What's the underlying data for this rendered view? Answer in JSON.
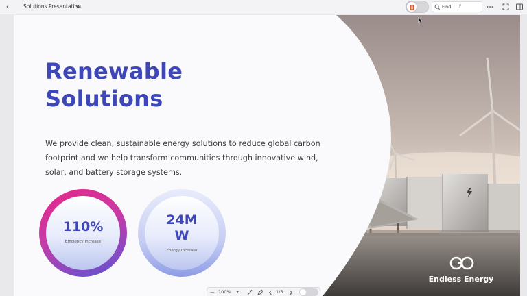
{
  "toolbar": {
    "back_icon": "chevron-left-icon",
    "document_title": "Solutions Presentation",
    "find_label": "Find",
    "find_shortcut": "F",
    "more_icon": "more-horizontal-icon",
    "fullscreen_icon": "fullscreen-icon",
    "sidebar_icon": "sidebar-toggle-icon"
  },
  "slide": {
    "headline_lines": [
      "Renewable",
      "Solutions"
    ],
    "description_lines": [
      "We provide clean, sustainable energy solutions to reduce global carbon",
      "footprint and we help transform communities through innovative wind,",
      "solar, and battery storage systems."
    ],
    "stats": [
      {
        "value_lines": [
          "110%"
        ],
        "label": "Efficiency Increase"
      },
      {
        "value_lines": [
          "24M",
          "W"
        ],
        "label": "Energy Increase"
      }
    ],
    "brand_name": "Endless Energy"
  },
  "zoom_bar": {
    "zoom_out": "—",
    "zoom_level": "100%",
    "zoom_in": "+",
    "page": "1/5"
  },
  "colors": {
    "accent": "#3d47b8",
    "stat_ring_start": "#e52787",
    "stat_ring_end": "#5a55d5"
  }
}
